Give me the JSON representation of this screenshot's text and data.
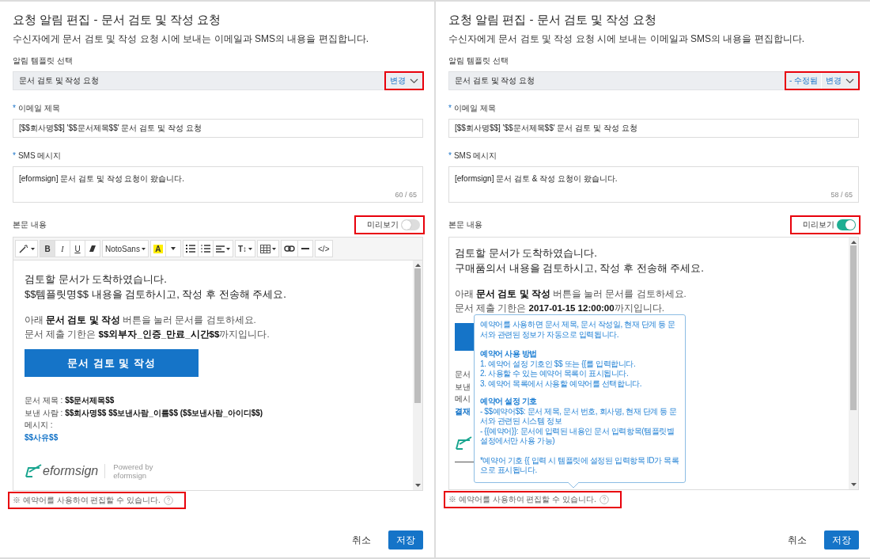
{
  "panels": [
    {
      "title": "요청 알림 편집 - 문서 검토 및 작성 요청",
      "description": "수신자에게 문서 검토 및 작성 요청 시에 보내는 이메일과 SMS의 내용을 편집합니다.",
      "template": {
        "label": "알림 템플릿 선택",
        "value": "문서 검토 및 작성 요청",
        "change_label": "변경",
        "highlighted": true
      },
      "email_subject": {
        "required_mark": "*",
        "label": "이메일 제목",
        "value": "[$$회사명$$] '$$문서제목$$' 문서 검토 및 작성 요청"
      },
      "sms": {
        "required_mark": "*",
        "label": "SMS 메시지",
        "value": "[eformsign] 문서 검토 및 작성 요청이 왔습니다.",
        "count": "60 / 65"
      },
      "body": {
        "label": "본문 내용",
        "preview_toggle": {
          "label": "미리보기",
          "on": false,
          "highlighted": true
        },
        "toolbar": [
          [
            {
              "kind": "wand",
              "dropdown": true,
              "selected": false
            }
          ],
          [
            {
              "kind": "bold",
              "label": "B",
              "selected": true
            },
            {
              "kind": "italic",
              "label": "I",
              "selected": false
            },
            {
              "kind": "underline",
              "label": "U",
              "selected": false
            },
            {
              "kind": "eraser",
              "selected": false
            }
          ],
          [
            {
              "kind": "text",
              "label": "NotoSans",
              "dropdown": true,
              "selected": false
            }
          ],
          [
            {
              "kind": "highlight",
              "label": "A",
              "selected": false
            },
            {
              "kind": "caret",
              "selected": false
            }
          ],
          [
            {
              "kind": "bullets",
              "selected": false
            },
            {
              "kind": "numbers",
              "selected": false
            },
            {
              "kind": "align",
              "dropdown": true,
              "selected": false
            }
          ],
          [
            {
              "kind": "bold",
              "label": "T↕",
              "dropdown": true,
              "selected": false
            }
          ],
          [
            {
              "kind": "table",
              "dropdown": true,
              "selected": false
            }
          ],
          [
            {
              "kind": "link",
              "selected": false
            },
            {
              "kind": "rule",
              "selected": false
            }
          ],
          [
            {
              "kind": "text",
              "label": "</>",
              "selected": false
            }
          ]
        ],
        "headings": [
          "검토할 문서가 도착하였습니다.",
          "$$템플릿명$$ 내용을 검토하시고, 작성 후 전송해 주세요."
        ],
        "paragraphs": [
          "아래 **문서 검토 및 작성** 버튼을 눌러 문서를 검토하세요.",
          "문서 제출 기한은 **$$외부자_인증_만료_시간$$**까지입니다."
        ],
        "action_button": {
          "kind": "labeled",
          "label": "문서 검토 및 작성"
        },
        "info_lines": [
          {
            "kind": "plain",
            "text": "문서 제목 : **$$문서제목$$**"
          },
          {
            "kind": "plain",
            "text": "보낸 사람 : **$$회사명$$ $$보낸사람_이름$$ ($$보낸사람_아이디$$)**"
          },
          {
            "kind": "plain",
            "text": "메시지 :"
          },
          {
            "kind": "variable",
            "text": "$$사유$$"
          }
        ],
        "footer": {
          "kind": "logo",
          "brand": "eformsign",
          "powered_by": [
            "Powered by",
            "eformsign"
          ]
        }
      },
      "hint": {
        "text": "※ 예약어를 사용하여 편집할 수 있습니다.",
        "highlighted": true
      },
      "buttons": [
        {
          "label": "취소",
          "kind": "secondary"
        },
        {
          "label": "저장",
          "kind": "primary"
        }
      ]
    },
    {
      "title": "요청 알림 편집 - 문서 검토 및 작성 요청",
      "description": "수신자에게 문서 검토 및 작성 요청 시에 보내는 이메일과 SMS의 내용을 편집합니다.",
      "template": {
        "label": "알림 템플릿 선택",
        "value": "문서 검토 및 작성 요청",
        "modified_tag": "- 수정됨",
        "change_label": "변경",
        "highlighted": true
      },
      "email_subject": {
        "required_mark": "*",
        "label": "이메일 제목",
        "value": "[$$회사명$$] '$$문서제목$$' 문서 검토 및 작성 요청"
      },
      "sms": {
        "required_mark": "*",
        "label": "SMS 메시지",
        "value": "[eformsign] 문서 검토 & 작성 요청이 왔습니다.",
        "count": "58 / 65"
      },
      "body": {
        "label": "본문 내용",
        "preview_toggle": {
          "label": "미리보기",
          "on": true,
          "highlighted": true
        },
        "headings": [
          "검토할 문서가 도착하였습니다.",
          "구매품의서 내용을 검토하시고, 작성 후 전송해 주세요."
        ],
        "paragraphs": [
          "아래 **문서 검토 및 작성** 버튼을 눌러 문서를 검토하세요.",
          "문서 제출 기한은 **2017-01-15 12:00:00**까지입니다."
        ],
        "action_button": {
          "kind": "cropped"
        },
        "info_lines": [
          {
            "kind": "plain",
            "text": "문서"
          },
          {
            "kind": "plain",
            "text": "보낸"
          },
          {
            "kind": "plain",
            "text": "메시"
          },
          {
            "kind": "variable",
            "text": "결재"
          }
        ],
        "footer": {
          "kind": "divider"
        },
        "tooltip": [
          {
            "kind": "text",
            "text": "예약어를 사용하면 문서 제목, 문서 작성일, 현재 단계 등 문서와 관련된 정보가 자동으로 입력됩니다."
          },
          {
            "kind": "heading",
            "text": "예약어 사용 방법"
          },
          {
            "kind": "line",
            "text": "1. 예약어 설정 기호인 $$ 또는 {{를 입력합니다."
          },
          {
            "kind": "line",
            "text": "2. 사용할 수 있는 예약어 목록이 표시됩니다."
          },
          {
            "kind": "line",
            "text": "3. 예약어 목록에서 사용할 예약어를 선택합니다."
          },
          {
            "kind": "heading",
            "text": "예약어 설정 기호"
          },
          {
            "kind": "line",
            "text": "- $$예약어$$: 문서 제목, 문서 번호, 회사명, 현재 단계 등 문서와 관련된 시스템 정보"
          },
          {
            "kind": "line",
            "text": "- {{예약어}}: 문서에 입력된 내용인 문서 입력항목(템플릿별 설정에서만 사용 가능)"
          },
          {
            "kind": "text",
            "text": "*예약어 기호 {{ 입력 시 템플릿에 설정된 입력항목 ID가 목록으로 표시됩니다."
          }
        ]
      },
      "hint": {
        "text": "※ 예약어를 사용하여 편집할 수 있습니다.",
        "highlighted": true
      },
      "buttons": [
        {
          "label": "취소",
          "kind": "secondary"
        },
        {
          "label": "저장",
          "kind": "primary"
        }
      ]
    }
  ]
}
